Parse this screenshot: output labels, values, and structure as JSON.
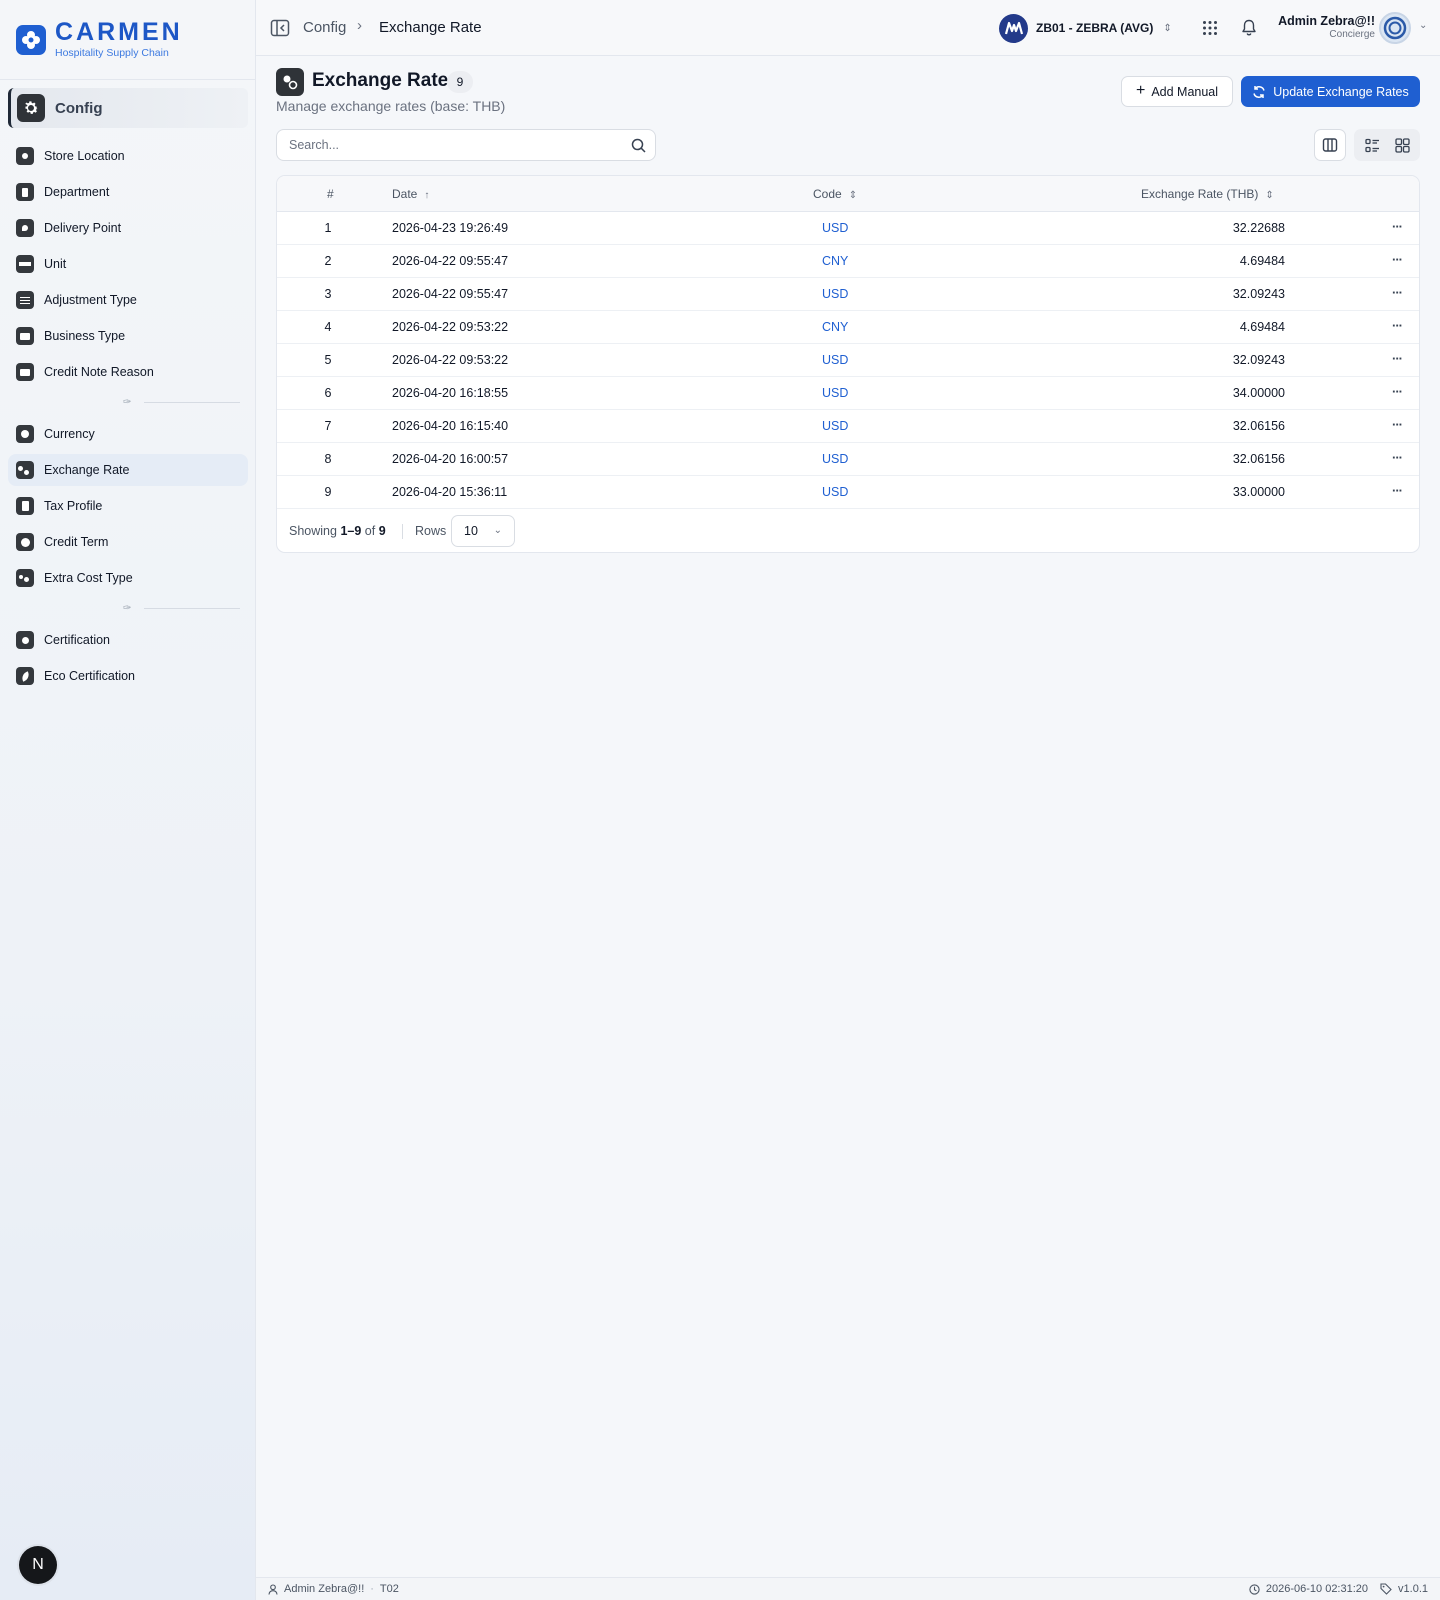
{
  "brand": {
    "name": "CARMEN",
    "subtitle": "Hospitality Supply Chain"
  },
  "sidebar": {
    "section_title": "Config",
    "groups": [
      [
        "Store Location",
        "Department",
        "Delivery Point",
        "Unit",
        "Adjustment Type",
        "Business Type",
        "Credit Note Reason"
      ],
      [
        "Currency",
        "Exchange Rate",
        "Tax Profile",
        "Credit Term",
        "Extra Cost Type"
      ],
      [
        "Certification",
        "Eco Certification"
      ]
    ],
    "items": [
      {
        "label": "Store Location",
        "icon": "map-pin-icon"
      },
      {
        "label": "Department",
        "icon": "building-icon"
      },
      {
        "label": "Delivery Point",
        "icon": "location-icon"
      },
      {
        "label": "Unit",
        "icon": "ruler-icon"
      },
      {
        "label": "Adjustment Type",
        "icon": "sliders-icon"
      },
      {
        "label": "Business Type",
        "icon": "briefcase-icon"
      },
      {
        "label": "Credit Note Reason",
        "icon": "message-icon"
      },
      {
        "label": "Currency",
        "icon": "coin-icon"
      },
      {
        "label": "Exchange Rate",
        "icon": "exchange-icon",
        "active": true
      },
      {
        "label": "Tax Profile",
        "icon": "document-icon"
      },
      {
        "label": "Credit Term",
        "icon": "clock-icon"
      },
      {
        "label": "Extra Cost Type",
        "icon": "coins-icon"
      },
      {
        "label": "Certification",
        "icon": "award-icon"
      },
      {
        "label": "Eco Certification",
        "icon": "leaf-icon"
      }
    ],
    "footer_button": "N"
  },
  "topbar": {
    "breadcrumb_root": "Config",
    "breadcrumb_current": "Exchange Rate",
    "tenant": "ZB01 - ZEBRA (AVG)",
    "user_name": "Admin Zebra@!!",
    "user_role": "Concierge"
  },
  "page": {
    "title": "Exchange Rate",
    "count": "9",
    "subtitle": "Manage exchange rates (base: THB)",
    "add_button": "Add Manual",
    "update_button": "Update Exchange Rates",
    "search_placeholder": "Search..."
  },
  "table": {
    "columns": {
      "num": "#",
      "date": "Date",
      "code": "Code",
      "rate": "Exchange Rate (THB)"
    },
    "rows": [
      {
        "num": "1",
        "date": "2026-04-23 19:26:49",
        "code": "USD",
        "rate": "32.22688"
      },
      {
        "num": "2",
        "date": "2026-04-22 09:55:47",
        "code": "CNY",
        "rate": "4.69484"
      },
      {
        "num": "3",
        "date": "2026-04-22 09:55:47",
        "code": "USD",
        "rate": "32.09243"
      },
      {
        "num": "4",
        "date": "2026-04-22 09:53:22",
        "code": "CNY",
        "rate": "4.69484"
      },
      {
        "num": "5",
        "date": "2026-04-22 09:53:22",
        "code": "USD",
        "rate": "32.09243"
      },
      {
        "num": "6",
        "date": "2026-04-20 16:18:55",
        "code": "USD",
        "rate": "34.00000"
      },
      {
        "num": "7",
        "date": "2026-04-20 16:15:40",
        "code": "USD",
        "rate": "32.06156"
      },
      {
        "num": "8",
        "date": "2026-04-20 16:00:57",
        "code": "USD",
        "rate": "32.06156"
      },
      {
        "num": "9",
        "date": "2026-04-20 15:36:11",
        "code": "USD",
        "rate": "33.00000"
      }
    ],
    "footer": {
      "showing_label": "Showing",
      "range": "1–9",
      "of_label": "of",
      "total": "9",
      "rows_label": "Rows",
      "rows_value": "10"
    }
  },
  "statusbar": {
    "user": "Admin Zebra@!!",
    "code": "T02",
    "timestamp": "2026-06-10 02:31:20",
    "version": "v1.0.1"
  },
  "colors": {
    "accent": "#1f5fd1",
    "sidebar_bg": "#eef2f7",
    "dark_icon": "#2f3338"
  }
}
